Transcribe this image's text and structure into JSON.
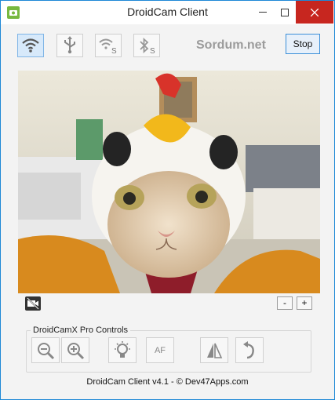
{
  "window": {
    "title": "DroidCam Client",
    "controls": [
      "minimize",
      "maximize",
      "close"
    ]
  },
  "toolbar": {
    "modes": [
      {
        "name": "wifi-mode",
        "icon": "wifi-icon"
      },
      {
        "name": "usb-mode",
        "icon": "usb-icon"
      },
      {
        "name": "wifi-server-mode",
        "icon": "wifi-s-icon"
      },
      {
        "name": "bluetooth-server-mode",
        "icon": "bluetooth-s-icon"
      }
    ],
    "brand": "Sordum.net",
    "stop_label": "Stop"
  },
  "video": {
    "subject": "cat wearing chicken costume"
  },
  "video_controls": {
    "minus_label": "-",
    "plus_label": "+"
  },
  "pro": {
    "label": "DroidCamX Pro Controls",
    "buttons": [
      {
        "name": "zoom-out",
        "icon": "zoom-out-icon"
      },
      {
        "name": "zoom-in",
        "icon": "zoom-in-icon"
      },
      {
        "name": "light",
        "icon": "lightbulb-icon"
      },
      {
        "name": "autofocus",
        "label": "AF"
      },
      {
        "name": "flip",
        "icon": "flip-icon"
      },
      {
        "name": "rotate",
        "icon": "rotate-icon"
      }
    ]
  },
  "footer": {
    "text": "DroidCam Client v4.1 - © Dev47Apps.com"
  },
  "colors": {
    "accent": "#3b8fd9",
    "close": "#c7261f",
    "brand": "#9b9b9b"
  }
}
